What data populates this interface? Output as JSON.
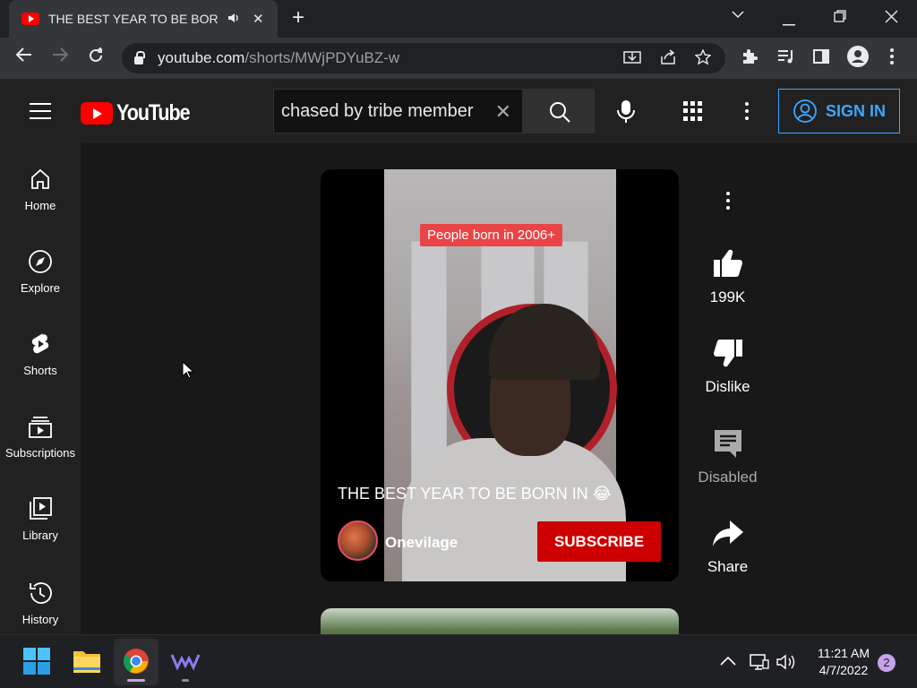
{
  "browser": {
    "tab": {
      "title": "THE BEST YEAR TO BE BORN IN 😂 - YouTube",
      "audio_icon": "speaker-icon",
      "close_label": "✕"
    },
    "new_tab_label": "+",
    "url": {
      "host": "youtube.com",
      "path": "/shorts/MWjPDYuBZ-w"
    },
    "window_controls": {
      "dropdown": "⌄",
      "minimize": "—",
      "restore": "❐",
      "close": "✕"
    }
  },
  "header": {
    "logo_text": "YouTube",
    "search": {
      "value": "chased by tribe member",
      "clear_label": "✕"
    },
    "sign_in_label": "SIGN IN"
  },
  "sidebar": {
    "items": [
      {
        "label": "Home",
        "icon": "home-icon"
      },
      {
        "label": "Explore",
        "icon": "compass-icon"
      },
      {
        "label": "Shorts",
        "icon": "shorts-icon"
      },
      {
        "label": "Subscriptions",
        "icon": "subscriptions-icon"
      },
      {
        "label": "Library",
        "icon": "library-icon"
      },
      {
        "label": "History",
        "icon": "history-icon"
      }
    ]
  },
  "short": {
    "overlay_caption": "People born in 2006+",
    "title": "THE BEST YEAR TO BE BORN IN 😂",
    "channel": "Onevilage",
    "subscribe_label": "SUBSCRIBE"
  },
  "actions": {
    "like_count": "199K",
    "dislike_label": "Dislike",
    "comments_label": "Disabled",
    "share_label": "Share"
  },
  "taskbar": {
    "time": "11:21 AM",
    "date": "4/7/2022",
    "notifications": "2"
  },
  "colors": {
    "brand_red": "#ff0000",
    "subscribe_red": "#cc0000",
    "link_blue": "#3ea6ff"
  }
}
